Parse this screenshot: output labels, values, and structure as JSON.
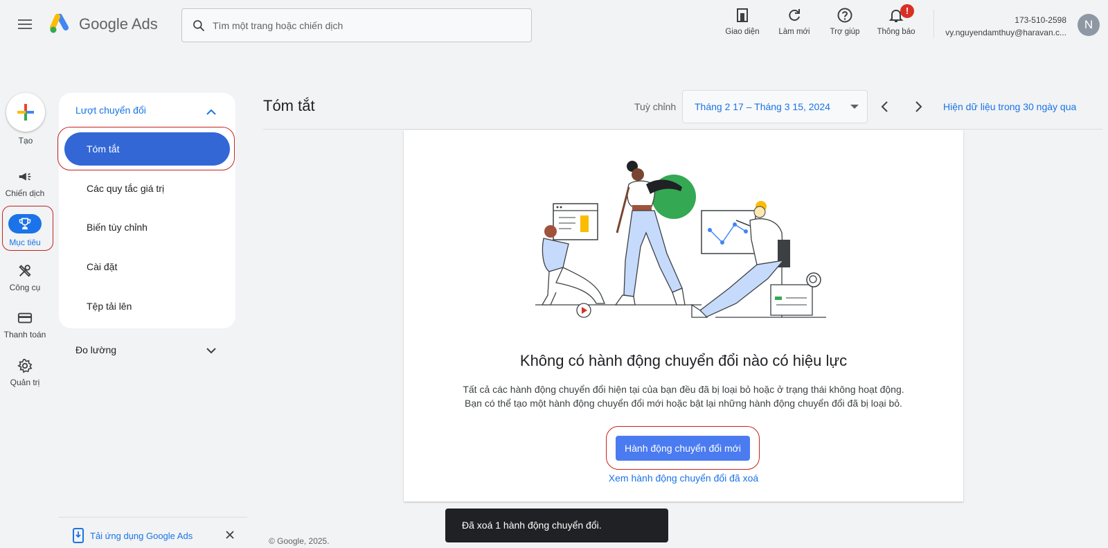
{
  "header": {
    "app_name": "Google Ads",
    "search_placeholder": "Tìm một trang hoặc chiến dịch",
    "tools": [
      {
        "label": "Giao diện",
        "icon": "appearance-icon"
      },
      {
        "label": "Làm mới",
        "icon": "refresh-icon"
      },
      {
        "label": "Trợ giúp",
        "icon": "help-icon"
      },
      {
        "label": "Thông báo",
        "icon": "bell-icon",
        "badge": "!"
      }
    ],
    "account_id": "173-510-2598",
    "account_email": "vy.nguyendamthuy@haravan.c...",
    "avatar_initial": "N"
  },
  "rail": {
    "create_label": "Tạo",
    "items": [
      {
        "label": "Chiến dịch",
        "icon": "megaphone-icon"
      },
      {
        "label": "Mục tiêu",
        "icon": "trophy-icon",
        "active": true
      },
      {
        "label": "Công cụ",
        "icon": "tools-icon"
      },
      {
        "label": "Thanh toán",
        "icon": "credit-card-icon"
      },
      {
        "label": "Quản trị",
        "icon": "gear-icon"
      }
    ]
  },
  "nav": {
    "group_title": "Lượt chuyển đổi",
    "items": [
      {
        "label": "Tóm tắt",
        "active": true
      },
      {
        "label": "Các quy tắc giá trị"
      },
      {
        "label": "Biến tùy chỉnh"
      },
      {
        "label": "Cài đặt"
      },
      {
        "label": "Tệp tải lên"
      }
    ],
    "measurement": "Đo lường",
    "app_promo": "Tải ứng dụng Google Ads"
  },
  "main": {
    "title": "Tóm tắt",
    "customize_label": "Tuỳ chỉnh",
    "date_range": "Tháng 2 17 – Tháng 3 15, 2024",
    "last_30_link": "Hiện dữ liệu trong 30 ngày qua",
    "empty_title": "Không có hành động chuyển đổi nào có hiệu lực",
    "empty_desc": "Tất cả các hành động chuyển đổi hiện tại của bạn đều đã bị loại bỏ hoặc ở trạng thái không hoạt động. Bạn có thể tạo một hành động chuyển đổi mới hoặc bật lại những hành động chuyển đổi đã bị loại bỏ.",
    "primary_button": "Hành động chuyển đổi mới",
    "removed_link": "Xem hành động chuyển đổi đã xoá"
  },
  "snackbar": "Đã xoá 1 hành động chuyển đổi.",
  "footer": "© Google, 2025.",
  "colors": {
    "accent": "#1a73e8",
    "active_nav": "#3367d6",
    "highlight": "#c5221f",
    "badge": "#d93025"
  }
}
